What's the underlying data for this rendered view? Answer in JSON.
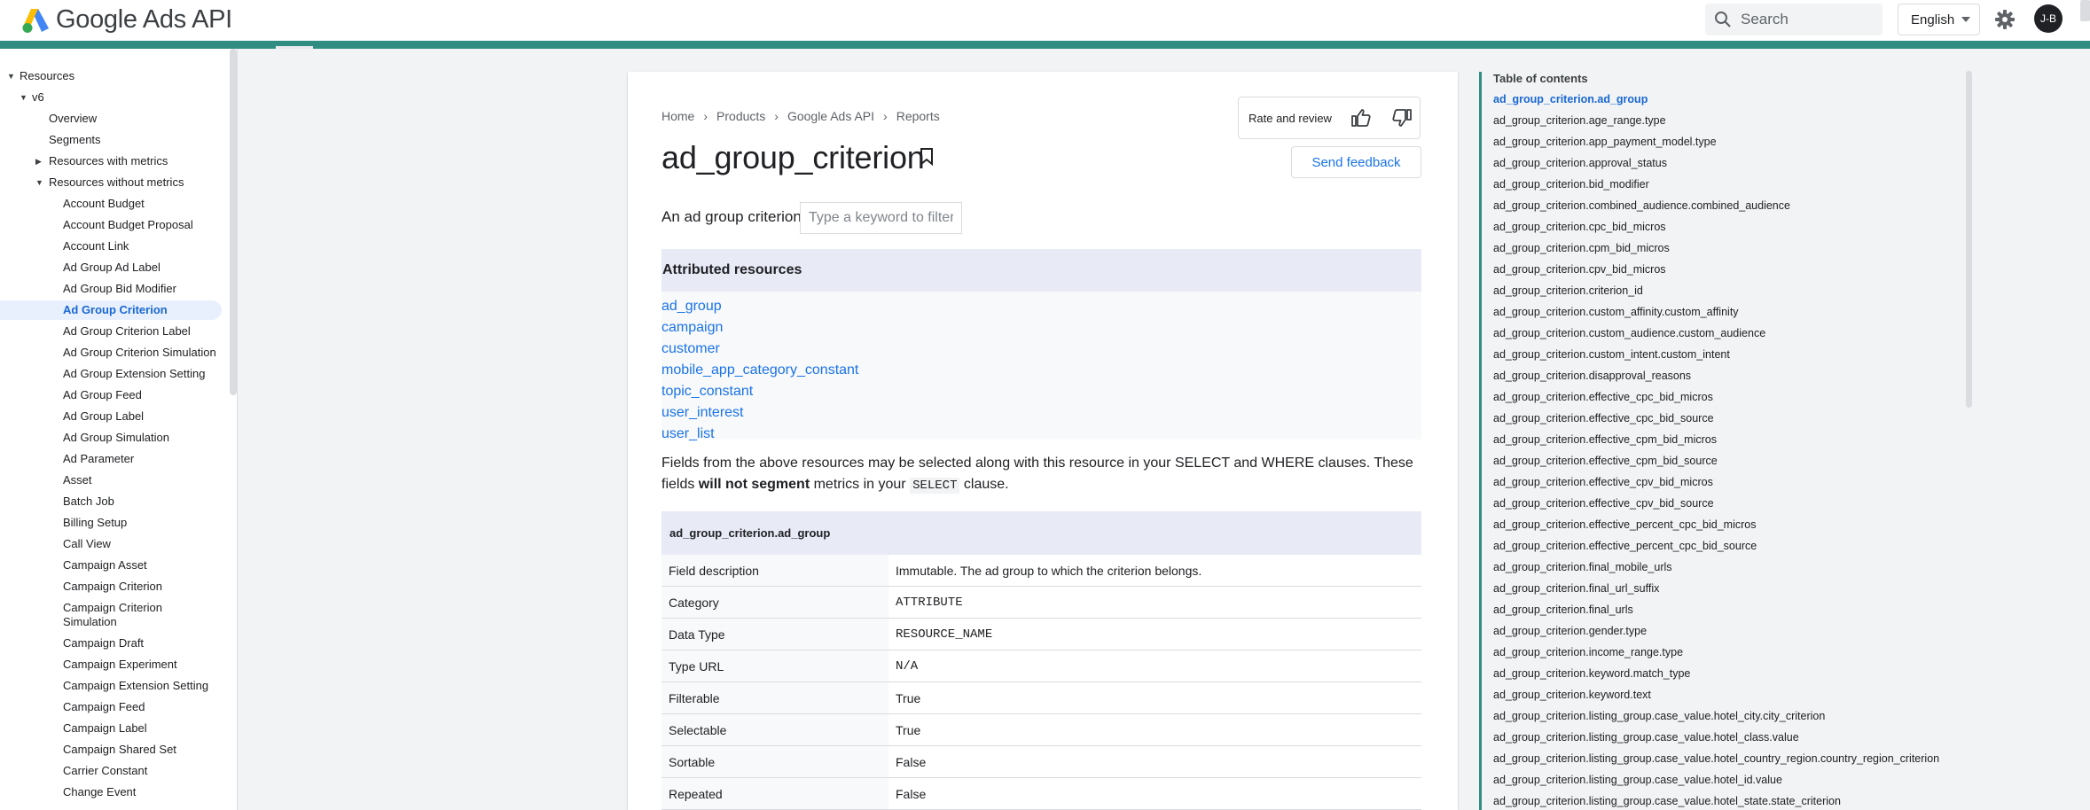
{
  "header": {
    "logo_text": "Google Ads API",
    "search_placeholder": "Search",
    "language": "English",
    "avatar_initials": "J-B",
    "stripe_color": "#2f8d82"
  },
  "nav": {
    "items": [
      {
        "label": "Resources",
        "level": 0,
        "caret": "down"
      },
      {
        "label": "v6",
        "level": 1,
        "caret": "down"
      },
      {
        "label": "Overview",
        "level": 2
      },
      {
        "label": "Segments",
        "level": 2
      },
      {
        "label": "Resources with metrics",
        "level": 2,
        "caret": "right"
      },
      {
        "label": "Resources without metrics",
        "level": 2,
        "caret": "down"
      },
      {
        "label": "Account Budget",
        "level": 3
      },
      {
        "label": "Account Budget Proposal",
        "level": 3
      },
      {
        "label": "Account Link",
        "level": 3
      },
      {
        "label": "Ad Group Ad Label",
        "level": 3
      },
      {
        "label": "Ad Group Bid Modifier",
        "level": 3
      },
      {
        "label": "Ad Group Criterion",
        "level": 3,
        "active": true
      },
      {
        "label": "Ad Group Criterion Label",
        "level": 3
      },
      {
        "label": "Ad Group Criterion Simulation",
        "level": 3
      },
      {
        "label": "Ad Group Extension Setting",
        "level": 3
      },
      {
        "label": "Ad Group Feed",
        "level": 3
      },
      {
        "label": "Ad Group Label",
        "level": 3
      },
      {
        "label": "Ad Group Simulation",
        "level": 3
      },
      {
        "label": "Ad Parameter",
        "level": 3
      },
      {
        "label": "Asset",
        "level": 3
      },
      {
        "label": "Batch Job",
        "level": 3
      },
      {
        "label": "Billing Setup",
        "level": 3
      },
      {
        "label": "Call View",
        "level": 3
      },
      {
        "label": "Campaign Asset",
        "level": 3
      },
      {
        "label": "Campaign Criterion",
        "level": 3
      },
      {
        "label": "Campaign Criterion",
        "label2": "Simulation",
        "level": 3
      },
      {
        "label": "Campaign Draft",
        "level": 3
      },
      {
        "label": "Campaign Experiment",
        "level": 3
      },
      {
        "label": "Campaign Extension Setting",
        "level": 3
      },
      {
        "label": "Campaign Feed",
        "level": 3
      },
      {
        "label": "Campaign Label",
        "level": 3
      },
      {
        "label": "Campaign Shared Set",
        "level": 3
      },
      {
        "label": "Carrier Constant",
        "level": 3
      },
      {
        "label": "Change Event",
        "level": 3
      }
    ]
  },
  "main": {
    "breadcrumbs": [
      "Home",
      "Products",
      "Google Ads API",
      "Reports"
    ],
    "title": "ad_group_criterion",
    "rate_label": "Rate and review",
    "send_feedback": "Send feedback",
    "description": "An ad group criterion.",
    "filter_placeholder": "Type a keyword to filter",
    "attributed_heading": "Attributed resources",
    "attributed_links": [
      "ad_group",
      "campaign",
      "customer",
      "mobile_app_category_constant",
      "topic_constant",
      "user_interest",
      "user_list"
    ],
    "note_part1": "Fields from the above resources may be selected along with this resource in your SELECT and WHERE clauses. These fields ",
    "note_bold": "will not segment",
    "note_part2": " metrics in your ",
    "note_code": "SELECT",
    "note_part3": " clause.",
    "field": {
      "name": "ad_group_criterion.ad_group",
      "rows": [
        {
          "key": "Field description",
          "value": "Immutable. The ad group to which the criterion belongs.",
          "mono": false
        },
        {
          "key": "Category",
          "value": "ATTRIBUTE",
          "mono": true
        },
        {
          "key": "Data Type",
          "value": "RESOURCE_NAME",
          "mono": true
        },
        {
          "key": "Type URL",
          "value": "N/A",
          "mono": true
        },
        {
          "key": "Filterable",
          "value": "True",
          "mono": false
        },
        {
          "key": "Selectable",
          "value": "True",
          "mono": false
        },
        {
          "key": "Sortable",
          "value": "False",
          "mono": false
        },
        {
          "key": "Repeated",
          "value": "False",
          "mono": false
        }
      ]
    }
  },
  "toc": {
    "title": "Table of contents",
    "items": [
      "ad_group_criterion.ad_group",
      "ad_group_criterion.age_range.type",
      "ad_group_criterion.app_payment_model.type",
      "ad_group_criterion.approval_status",
      "ad_group_criterion.bid_modifier",
      "ad_group_criterion.combined_audience.combined_audience",
      "ad_group_criterion.cpc_bid_micros",
      "ad_group_criterion.cpm_bid_micros",
      "ad_group_criterion.cpv_bid_micros",
      "ad_group_criterion.criterion_id",
      "ad_group_criterion.custom_affinity.custom_affinity",
      "ad_group_criterion.custom_audience.custom_audience",
      "ad_group_criterion.custom_intent.custom_intent",
      "ad_group_criterion.disapproval_reasons",
      "ad_group_criterion.effective_cpc_bid_micros",
      "ad_group_criterion.effective_cpc_bid_source",
      "ad_group_criterion.effective_cpm_bid_micros",
      "ad_group_criterion.effective_cpm_bid_source",
      "ad_group_criterion.effective_cpv_bid_micros",
      "ad_group_criterion.effective_cpv_bid_source",
      "ad_group_criterion.effective_percent_cpc_bid_micros",
      "ad_group_criterion.effective_percent_cpc_bid_source",
      "ad_group_criterion.final_mobile_urls",
      "ad_group_criterion.final_url_suffix",
      "ad_group_criterion.final_urls",
      "ad_group_criterion.gender.type",
      "ad_group_criterion.income_range.type",
      "ad_group_criterion.keyword.match_type",
      "ad_group_criterion.keyword.text",
      "ad_group_criterion.listing_group.case_value.hotel_city.city_criterion",
      "ad_group_criterion.listing_group.case_value.hotel_class.value",
      "ad_group_criterion.listing_group.case_value.hotel_country_region.country_region_criterion",
      "ad_group_criterion.listing_group.case_value.hotel_id.value",
      "ad_group_criterion.listing_group.case_value.hotel_state.state_criterion"
    ]
  }
}
